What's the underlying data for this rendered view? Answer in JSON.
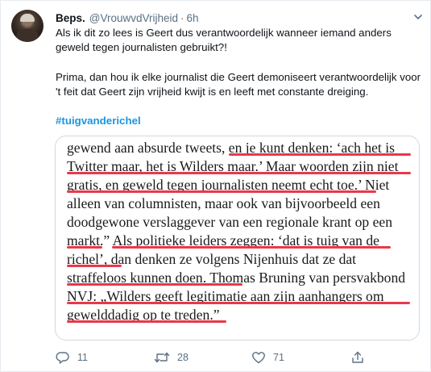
{
  "tweet": {
    "author_name": "Beps.",
    "author_handle": "@VrouwvdVrijheid",
    "separator": "·",
    "time": "6h",
    "text_1_line_1": "Als ik dit zo lees is Geert dus verantwoordelijk wanneer iemand anders",
    "text_1_line_2": "geweld tegen journalisten gebruikt?!",
    "text_2_line_1": "Prima, dan hou ik elke journalist die Geert demoniseert verantwoordelijk voor",
    "text_2_line_2": "'t feit dat Geert zijn vrijheid kwijt is en leeft met constante dreiging.",
    "hashtag": "#tuigvanderichel"
  },
  "article_lines": [
    "gewend aan absurde tweets, en je kunt denken: ‘ach het is",
    "Twitter maar, het is Wilders maar.’ Maar woorden zijn niet",
    "gratis, en geweld tegen journalisten neemt echt toe.’ Niet",
    "alleen van columnisten, maar ook van bijvoorbeeld een",
    "doodgewone verslaggever van een regionale krant op een",
    "markt.” Als politieke leiders zeggen: ‘dat is tuig van de",
    "richel’, dan denken ze volgens Nijenhuis dat ze dat",
    "straffeloos kunnen doen. Thomas Bruning van persvakbond",
    "NVJ: „Wilders geeft legitimatie aan zijn aanhangers om",
    "gewelddadig op te treden.”"
  ],
  "actions": {
    "reply_count": "11",
    "retweet_count": "28",
    "like_count": "71"
  },
  "colors": {
    "underline": "#e8394a",
    "hashtag": "#1b95e0",
    "muted": "#5b7083"
  },
  "icons": [
    "more-icon",
    "reply-icon",
    "retweet-icon",
    "like-icon",
    "share-icon"
  ]
}
